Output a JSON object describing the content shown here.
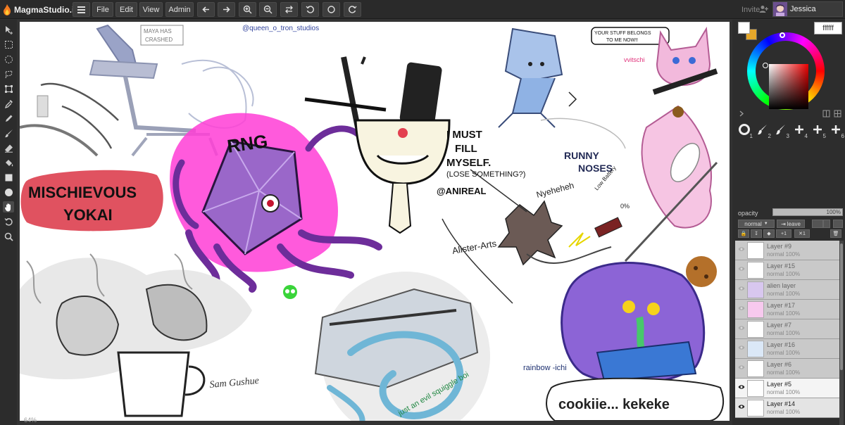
{
  "app": {
    "name": "MagmaStudio.io"
  },
  "menu": {
    "file": "File",
    "edit": "Edit",
    "view": "View",
    "admin": "Admin"
  },
  "header": {
    "invite_label": "Invite",
    "user_name": "Jessica"
  },
  "canvas_zoom": "64%",
  "canvas_text": {
    "maya_note": "MAYA HAS CRASHED",
    "handle_top": "@queen_o_tron_studios",
    "rng": "RNG",
    "yokai_line1": "MISCHIEVOUS",
    "yokai_line2": "YOKAI",
    "i_must_1": "I MUST",
    "i_must_2": "FILL",
    "i_must_3": "MYSELF.",
    "lose": "(LOSE SOMETHING?)",
    "anireal": "@ANIREAL",
    "runny_1": "RUNNY",
    "runny_2": "NOSES",
    "speech": "YOUR STUFF BELONGS TO ME NOW!!",
    "vvitschi": "vvitschi",
    "nyeheheh": "Nyeheheh",
    "low_battery": "Low Battery",
    "zero_pct": "0%",
    "alister": "Alister-Arts",
    "sam": "Sam Gushue",
    "squiggle": "just an evil squiggle boi",
    "rainbow": "rainbow -ichi",
    "cookie": "cookiie... kekeke"
  },
  "color_panel": {
    "hex_value": "ffffff",
    "primary_color": "#ffffff",
    "secondary_color": "#e5a72a"
  },
  "brushes": [
    "1",
    "2",
    "3",
    "4",
    "5",
    "6"
  ],
  "layer_panel": {
    "opacity_label": "opacity",
    "opacity_value": "100%",
    "blend_mode": "normal",
    "leave_label": "leave"
  },
  "layers": [
    {
      "name": "Layer #9",
      "mode": "normal 100%"
    },
    {
      "name": "Layer #15",
      "mode": "normal 100%"
    },
    {
      "name": "alien layer",
      "mode": "normal 100%"
    },
    {
      "name": "Layer #17",
      "mode": "normal 100%"
    },
    {
      "name": "Layer #7",
      "mode": "normal 100%"
    },
    {
      "name": "Layer #16",
      "mode": "normal 100%"
    },
    {
      "name": "Layer #6",
      "mode": "normal 100%"
    },
    {
      "name": "Layer #5",
      "mode": "normal 100%"
    },
    {
      "name": "Layer #14",
      "mode": "normal 100%"
    }
  ]
}
